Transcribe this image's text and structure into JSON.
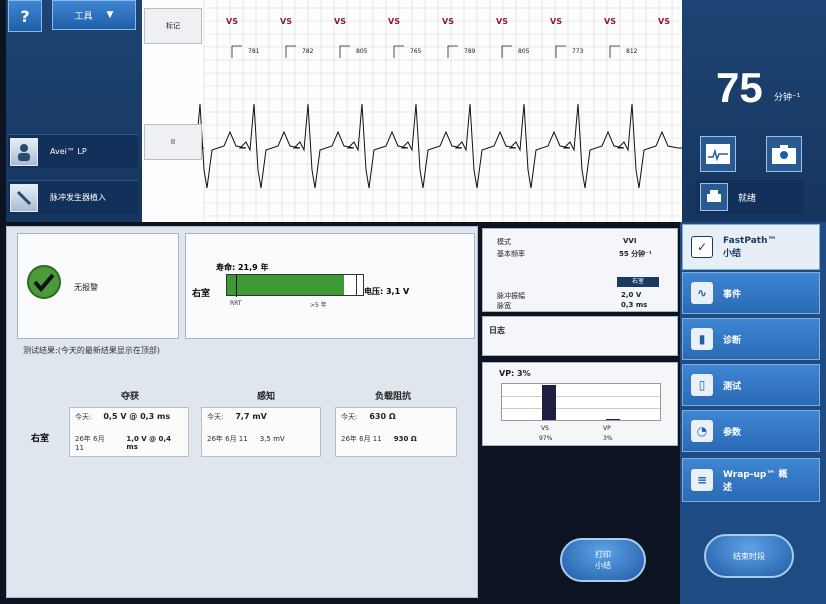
{
  "toolbar": {
    "help_label": "?",
    "tools_label": "工具",
    "tools_arrow": "▼"
  },
  "patient": {
    "device_label": "Avei™ LP",
    "implant_label": "脉冲发生器植入"
  },
  "ecg": {
    "mark_label": "标记",
    "lead_label": "II",
    "event_marker": "VS",
    "intervals": [
      "781",
      "782",
      "805",
      "765",
      "789",
      "805",
      "773",
      "812"
    ]
  },
  "heart_rate": {
    "value": "75",
    "unit": "分钟⁻¹"
  },
  "status": {
    "ready_label": "就绪"
  },
  "alerts": {
    "label": "无报警"
  },
  "battery": {
    "chamber": "右室",
    "life_label": "寿命: 21,9 年",
    "rrt_label": "RRT",
    "max_label": ">5 年",
    "voltage_label": "电压: 3,1 V",
    "fill_fraction": 0.86
  },
  "params": {
    "mode_label": "模式",
    "mode_value": "VVI",
    "base_rate_label": "基本频率",
    "base_rate_value": "55 分钟⁻¹",
    "chamber_badge": "右室",
    "amp_label": "脉冲振幅",
    "amp_value": "2,0 V",
    "width_label": "脉宽",
    "width_value": "0,3 ms"
  },
  "log": {
    "label": "日志"
  },
  "pacing": {
    "title": "VP: 3%",
    "vs_label": "VS",
    "vs_value": "97%",
    "vp_label": "VP",
    "vp_value": "3%",
    "vs_fraction": 0.97,
    "vp_fraction": 0.03
  },
  "results": {
    "header": "测试结果:(今天的最新结果显示在顶部)",
    "chamber": "右室",
    "columns": [
      "夺获",
      "感知",
      "负载阻抗"
    ],
    "today_label": "今天:",
    "capture": {
      "today": "0,5 V @ 0,3 ms",
      "prev_date": "26年 6月 11",
      "prev": "1,0 V @ 0,4 ms"
    },
    "sensing": {
      "today": "7,7 mV",
      "prev_date": "26年 6月 11",
      "prev": "3,5 mV"
    },
    "impedance": {
      "today": "630 Ω",
      "prev_date": "26年 6月 11",
      "prev": "930 Ω"
    }
  },
  "nav": {
    "fastpath_line1": "FastPath™",
    "fastpath_line2": "小结",
    "events": "事件",
    "diagnosis": "诊断",
    "test": "测试",
    "params": "参数",
    "wrapup_line1": "Wrap-up™ 概",
    "wrapup_line2": "述"
  },
  "actions": {
    "print_line1": "打印",
    "print_line2": "小结",
    "end_session": "结束时段"
  }
}
